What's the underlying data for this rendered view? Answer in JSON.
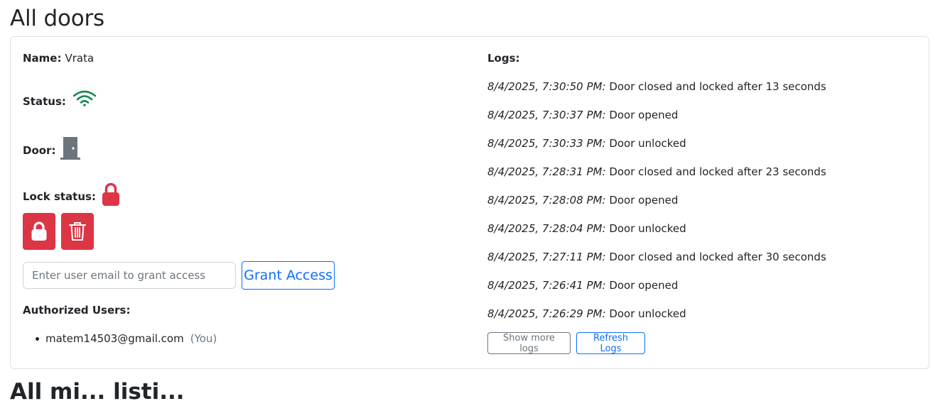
{
  "page": {
    "title": "All doors",
    "next_section_title": "All mi... listi..."
  },
  "door": {
    "name_label": "Name:",
    "name_value": "Vrata",
    "status_label": "Status:",
    "status_icon": "wifi-icon",
    "status_color": "#198754",
    "door_label": "Door:",
    "door_icon": "door-closed-icon",
    "door_color": "#6c757d",
    "lock_label": "Lock status:",
    "lock_icon": "lock-icon",
    "lock_color": "#dc3545"
  },
  "actions": {
    "lock_button_icon": "lock-icon",
    "delete_button_icon": "trash-icon",
    "button_color": "#dc3545"
  },
  "access": {
    "email_placeholder": "Enter user email to grant access",
    "email_value": "",
    "grant_label": "Grant Access"
  },
  "authorized": {
    "heading": "Authorized Users:",
    "users": [
      {
        "email": "matem14503@gmail.com",
        "tag": "(You)"
      }
    ]
  },
  "logs": {
    "heading": "Logs:",
    "entries": [
      {
        "time": "8/4/2025, 7:30:50 PM:",
        "message": "Door closed and locked after 13 seconds"
      },
      {
        "time": "8/4/2025, 7:30:37 PM:",
        "message": "Door opened"
      },
      {
        "time": "8/4/2025, 7:30:33 PM:",
        "message": "Door unlocked"
      },
      {
        "time": "8/4/2025, 7:28:31 PM:",
        "message": "Door closed and locked after 23 seconds"
      },
      {
        "time": "8/4/2025, 7:28:08 PM:",
        "message": "Door opened"
      },
      {
        "time": "8/4/2025, 7:28:04 PM:",
        "message": "Door unlocked"
      },
      {
        "time": "8/4/2025, 7:27:11 PM:",
        "message": "Door closed and locked after 30 seconds"
      },
      {
        "time": "8/4/2025, 7:26:41 PM:",
        "message": "Door opened"
      },
      {
        "time": "8/4/2025, 7:26:29 PM:",
        "message": "Door unlocked"
      }
    ],
    "show_more_label": "Show more logs",
    "refresh_label": "Refresh Logs"
  }
}
